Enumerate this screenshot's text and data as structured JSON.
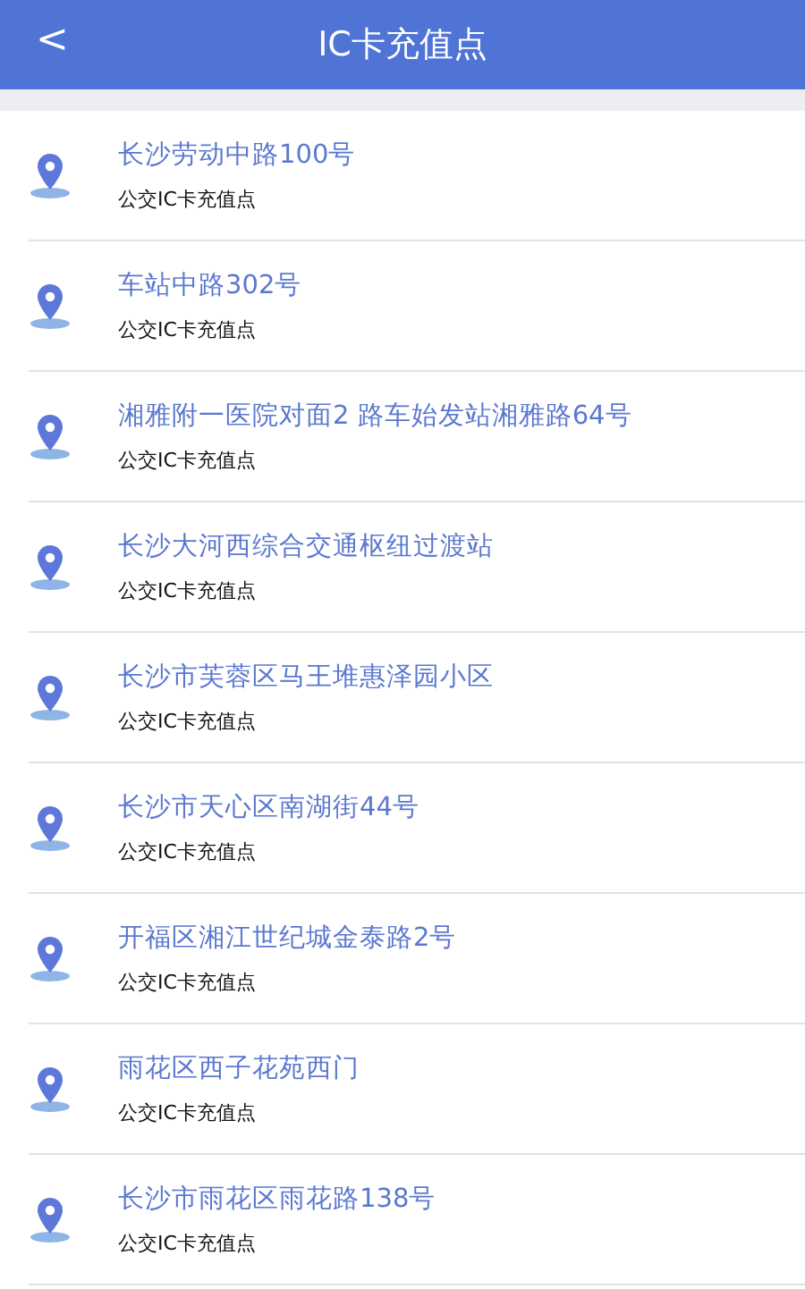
{
  "header": {
    "back": "<",
    "title": "IC卡充值点"
  },
  "items": [
    {
      "title": "长沙劳动中路100号",
      "subtitle": "公交IC卡充值点"
    },
    {
      "title": "车站中路302号",
      "subtitle": "公交IC卡充值点"
    },
    {
      "title": "湘雅附一医院对面2 路车始发站湘雅路64号",
      "subtitle": "公交IC卡充值点"
    },
    {
      "title": "长沙大河西综合交通枢纽过渡站",
      "subtitle": "公交IC卡充值点"
    },
    {
      "title": "长沙市芙蓉区马王堆惠泽园小区",
      "subtitle": "公交IC卡充值点"
    },
    {
      "title": "长沙市天心区南湖街44号",
      "subtitle": "公交IC卡充值点"
    },
    {
      "title": "开福区湘江世纪城金泰路2号",
      "subtitle": "公交IC卡充值点"
    },
    {
      "title": "雨花区西子花苑西门",
      "subtitle": "公交IC卡充值点"
    },
    {
      "title": "长沙市雨花区雨花路138号",
      "subtitle": "公交IC卡充值点"
    }
  ]
}
